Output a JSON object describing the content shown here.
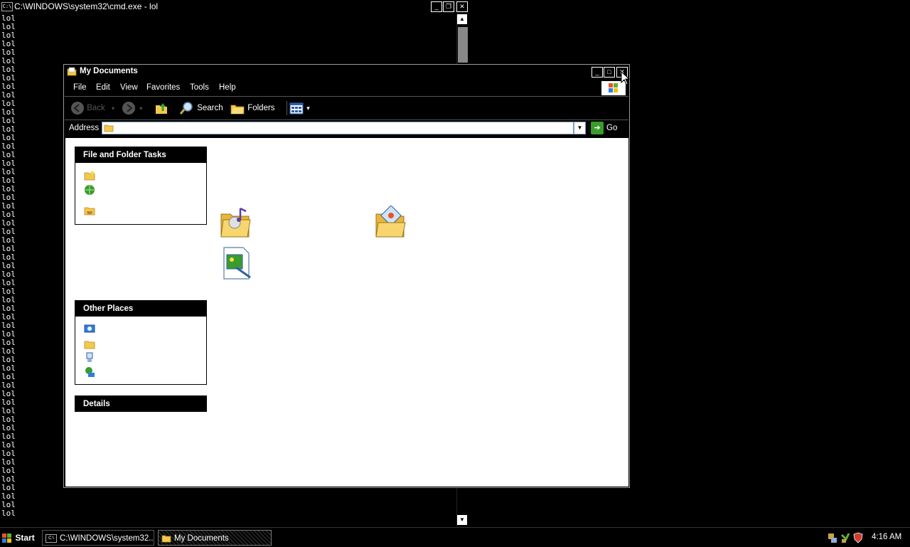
{
  "cmd": {
    "title": "C:\\WINDOWS\\system32\\cmd.exe - lol",
    "icon_text": "C:\\",
    "line_text": "lol",
    "line_count": 59,
    "controls": {
      "minimize": "_",
      "restore": "❐",
      "close": "✕"
    },
    "scroll_up": "▲",
    "scroll_down": "▼"
  },
  "explorer": {
    "title": "My Documents",
    "controls": {
      "minimize": "_",
      "maximize": "□",
      "close": "✕"
    },
    "menu": [
      "File",
      "Edit",
      "View",
      "Favorites",
      "Tools",
      "Help"
    ],
    "toolbar": {
      "back": "Back",
      "search": "Search",
      "folders": "Folders",
      "dropdown": "▾"
    },
    "address": {
      "label": "Address",
      "value": "",
      "dropdown": "▼",
      "go": "Go",
      "go_arrow": "➔"
    },
    "panels": {
      "file_tasks": "File and Folder Tasks",
      "other_places": "Other Places",
      "details": "Details"
    }
  },
  "taskbar": {
    "start": "Start",
    "tasks": [
      {
        "label": "C:\\WINDOWS\\system32..."
      },
      {
        "label": "My Documents"
      }
    ],
    "clock": "4:16 AM"
  },
  "colors": {
    "background": "#000000",
    "content": "#ffffff",
    "go_green": "#3a9c2b",
    "folder_yellow": "#f2c94c"
  }
}
